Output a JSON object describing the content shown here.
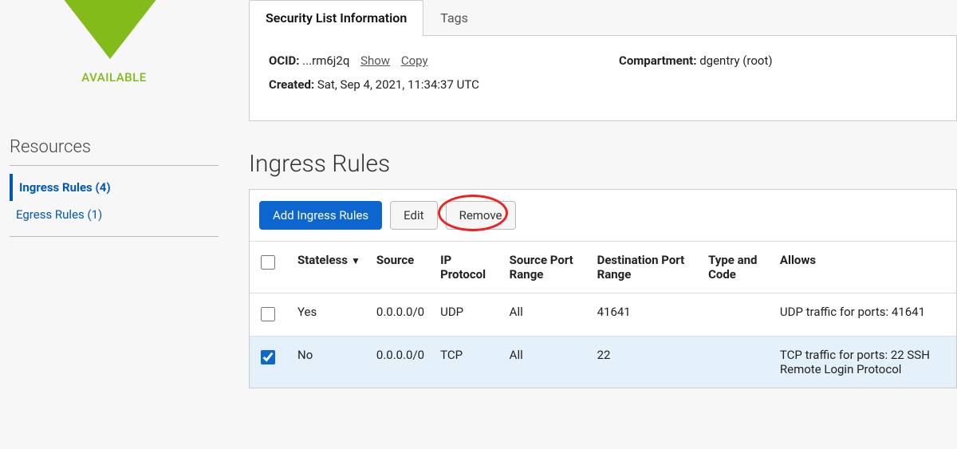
{
  "status": "AVAILABLE",
  "resources_header": "Resources",
  "resources": [
    {
      "label": "Ingress Rules (4)",
      "active": true
    },
    {
      "label": "Egress Rules (1)",
      "active": false
    }
  ],
  "tabs": [
    {
      "label": "Security List Information",
      "active": true
    },
    {
      "label": "Tags",
      "active": false
    }
  ],
  "info": {
    "ocid_label": "OCID:",
    "ocid_value": "...rm6j2q",
    "show": "Show",
    "copy": "Copy",
    "created_label": "Created:",
    "created_value": "Sat, Sep 4, 2021, 11:34:37 UTC",
    "compartment_label": "Compartment:",
    "compartment_value": "dgentry (root)"
  },
  "section_title": "Ingress Rules",
  "buttons": {
    "add": "Add Ingress Rules",
    "edit": "Edit",
    "remove": "Remove"
  },
  "columns": {
    "stateless": "Stateless",
    "source": "Source",
    "ip_protocol": "IP Protocol",
    "source_port_range": "Source Port Range",
    "destination_port_range": "Destination Port Range",
    "type_and_code": "Type and Code",
    "allows": "Allows"
  },
  "rows": [
    {
      "checked": false,
      "stateless": "Yes",
      "source": "0.0.0.0/0",
      "ip_protocol": "UDP",
      "source_port_range": "All",
      "destination_port_range": "41641",
      "type_and_code": "",
      "allows": "UDP traffic for ports: 41641"
    },
    {
      "checked": true,
      "stateless": "No",
      "source": "0.0.0.0/0",
      "ip_protocol": "TCP",
      "source_port_range": "All",
      "destination_port_range": "22",
      "type_and_code": "",
      "allows": "TCP traffic for ports: 22 SSH Remote Login Protocol"
    }
  ]
}
